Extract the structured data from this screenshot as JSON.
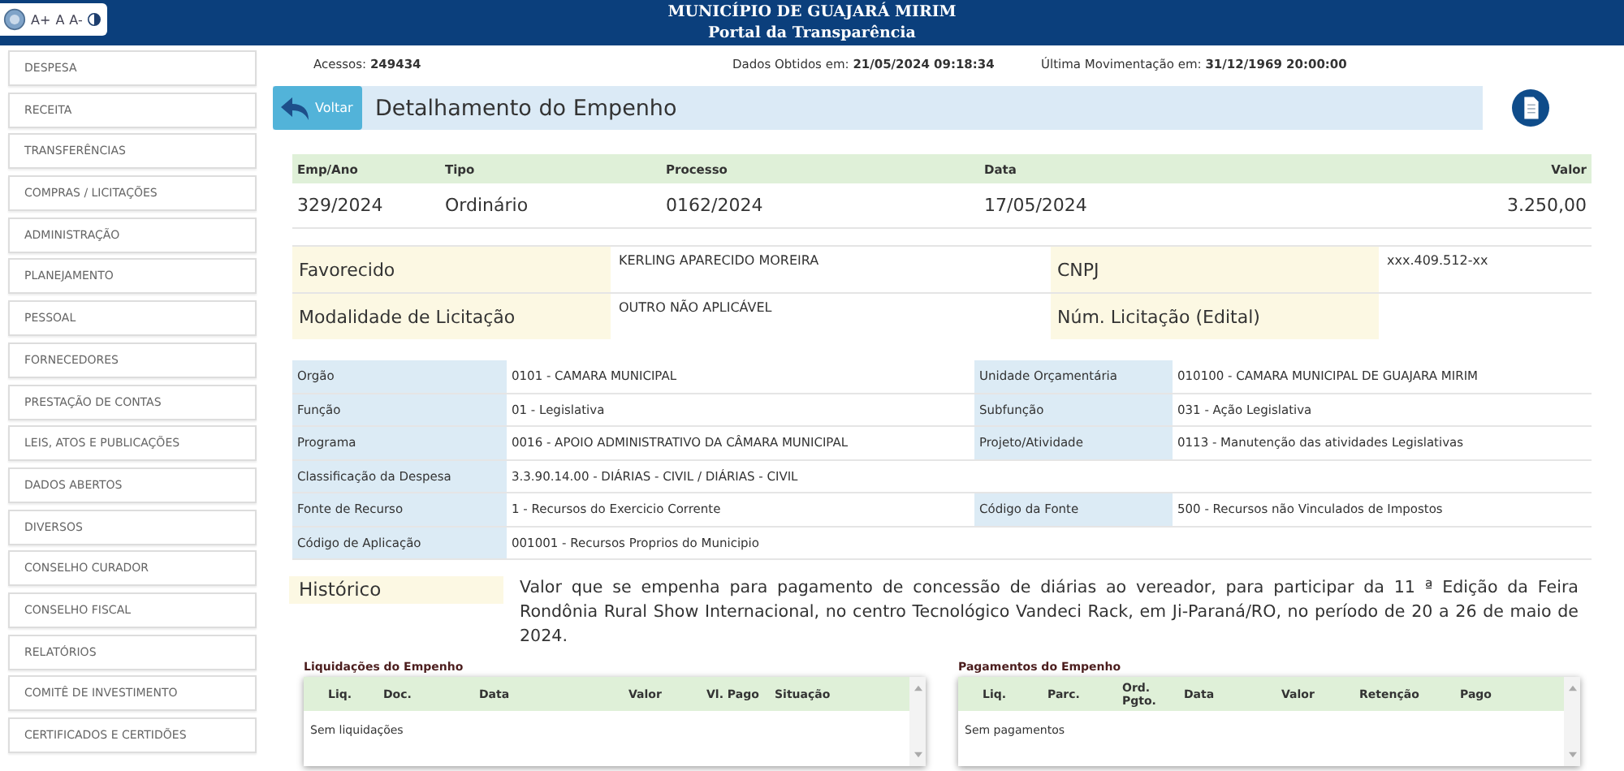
{
  "header": {
    "title": "MUNICÍPIO DE GUAJARÁ MIRIM",
    "subtitle": "Portal da Transparência"
  },
  "accessibility": {
    "buttons": [
      "A+",
      "A",
      "A-"
    ]
  },
  "sidebar": {
    "items": [
      "DESPESA",
      "RECEITA",
      "TRANSFERÊNCIAS",
      "COMPRAS / LICITAÇÕES",
      "ADMINISTRAÇÃO",
      "PLANEJAMENTO",
      "PESSOAL",
      "FORNECEDORES",
      "PRESTAÇÃO DE CONTAS",
      "LEIS, ATOS E PUBLICAÇÕES",
      "DADOS ABERTOS",
      "DIVERSOS",
      "CONSELHO CURADOR",
      "CONSELHO FISCAL",
      "RELATÓRIOS",
      "COMITÊ DE INVESTIMENTO",
      "CERTIFICADOS E CERTIDÕES"
    ]
  },
  "stats": [
    {
      "label": "Acessos:",
      "value": "249434"
    },
    {
      "label": "Dados Obtidos em:",
      "value": "21/05/2024 09:18:34"
    },
    {
      "label": "Última Movimentação em:",
      "value": "31/12/1969 20:00:00"
    }
  ],
  "back_button": "Voltar",
  "page_title": "Detalhamento do Empenho",
  "summary": {
    "columns": [
      "Emp/Ano",
      "Tipo",
      "Processo",
      "Data",
      "Valor"
    ],
    "row": [
      "329/2024",
      "Ordinário",
      "0162/2024",
      "17/05/2024",
      "3.250,00"
    ]
  },
  "parties": [
    [
      {
        "label": "Favorecido",
        "value": "KERLING APARECIDO MOREIRA"
      },
      {
        "label": "CNPJ",
        "value": "xxx.409.512-xx"
      }
    ],
    [
      {
        "label": "Modalidade de Licitação",
        "value": "OUTRO NÃO APLICÁVEL"
      },
      {
        "label": "Núm. Licitação (Edital)"
      }
    ]
  ],
  "details": [
    [
      {
        "label": "Orgão",
        "value": "0101 - CAMARA MUNICIPAL"
      },
      {
        "label": "Unidade Orçamentária",
        "value": "010100 - CAMARA MUNICIPAL DE GUAJARA MIRIM"
      }
    ],
    [
      {
        "label": "Função",
        "value": "01 - Legislativa"
      },
      {
        "label": "Subfunção",
        "value": "031 - Ação Legislativa"
      }
    ],
    [
      {
        "label": "Programa",
        "value": "0016 - APOIO ADMINISTRATIVO DA CÂMARA MUNICIPAL"
      },
      {
        "label": "Projeto/Atividade",
        "value": "0113 - Manutenção das atividades Legislativas"
      }
    ],
    [
      {
        "label": "Classificação da Despesa",
        "value": "3.3.90.14.00 - DIÁRIAS - CIVIL / DIÁRIAS - CIVIL"
      }
    ],
    [
      {
        "label": "Fonte de Recurso",
        "value": "1 - Recursos do Exercicio Corrente"
      },
      {
        "label": "Código da Fonte",
        "value": "500 - Recursos não Vinculados de Impostos"
      }
    ],
    [
      {
        "label": "Código de Aplicação",
        "value": "001001 - Recursos Proprios do Municipio"
      }
    ]
  ],
  "historico": {
    "label": "Histórico",
    "text": "Valor que se empenha para pagamento de concessão de diárias ao vereador, para participar da 11 ª Edição da Feira Rondônia Rural Show Internacional, no centro Tecnológico Vandeci Rack, em Ji-Paraná/RO, no período de 20 a 26 de maio de 2024."
  },
  "panels": [
    {
      "title": "Liquidações do Empenho",
      "columns": [
        "Liq.",
        "Doc.",
        "Data",
        "Valor",
        "Vl. Pago",
        "Situação"
      ],
      "empty_text": "Sem liquidações"
    },
    {
      "title": "Pagamentos do Empenho",
      "columns": [
        "Liq.",
        "Parc.",
        "Ord. Pgto.",
        "Data",
        "Valor",
        "Retenção",
        "Pago"
      ],
      "empty_text": "Sem pagamentos"
    }
  ]
}
